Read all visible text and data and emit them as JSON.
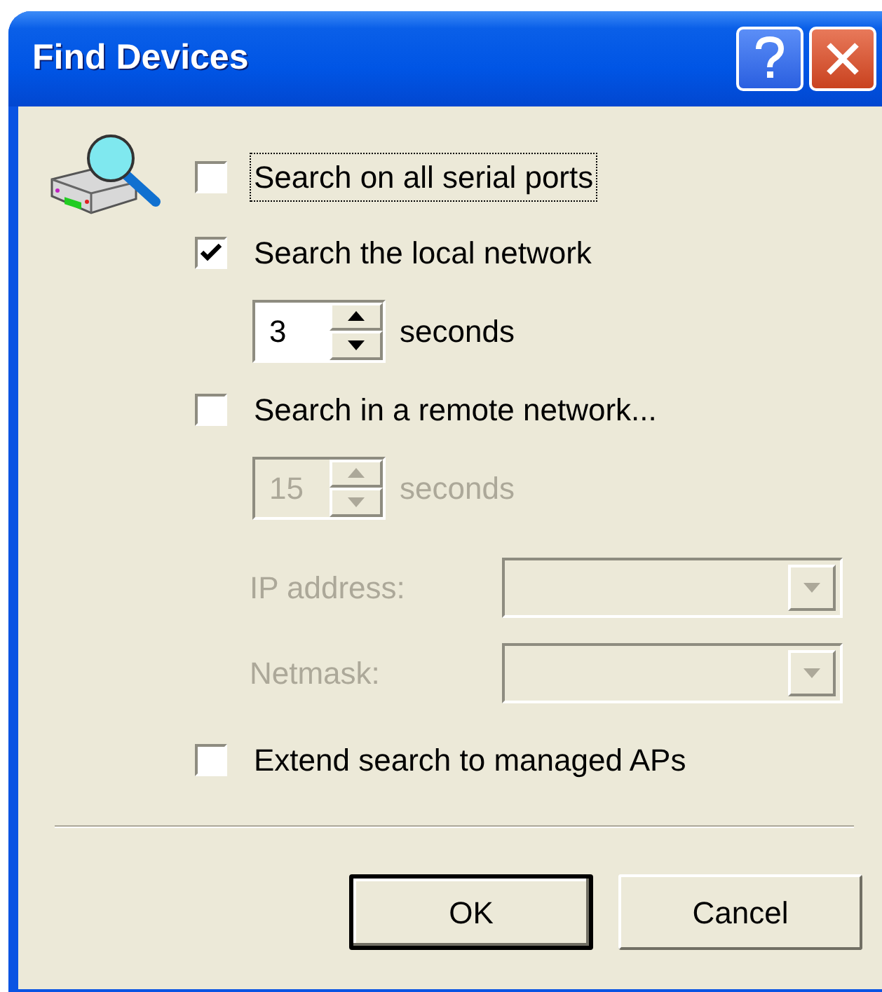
{
  "window": {
    "title": "Find Devices"
  },
  "options": [
    {
      "kind": "checkbox",
      "label": "Search on all serial ports",
      "checked": false,
      "focused": true,
      "disabled": false
    },
    {
      "kind": "checkbox",
      "label": "Search the local network",
      "checked": true,
      "focused": false,
      "disabled": false
    },
    {
      "kind": "spinner",
      "value": "3",
      "unit": "seconds",
      "disabled": false
    },
    {
      "kind": "checkbox",
      "label": "Search in a remote network...",
      "checked": false,
      "focused": false,
      "disabled": false
    },
    {
      "kind": "spinner",
      "value": "15",
      "unit": "seconds",
      "disabled": true
    },
    {
      "kind": "combo",
      "label": "IP address:",
      "disabled": true
    },
    {
      "kind": "combo",
      "label": "Netmask:",
      "disabled": true
    },
    {
      "kind": "checkbox",
      "label": "Extend search to managed APs",
      "checked": false,
      "focused": false,
      "disabled": false
    }
  ],
  "buttons": [
    {
      "label": "OK",
      "default": true
    },
    {
      "label": "Cancel",
      "default": false
    }
  ]
}
